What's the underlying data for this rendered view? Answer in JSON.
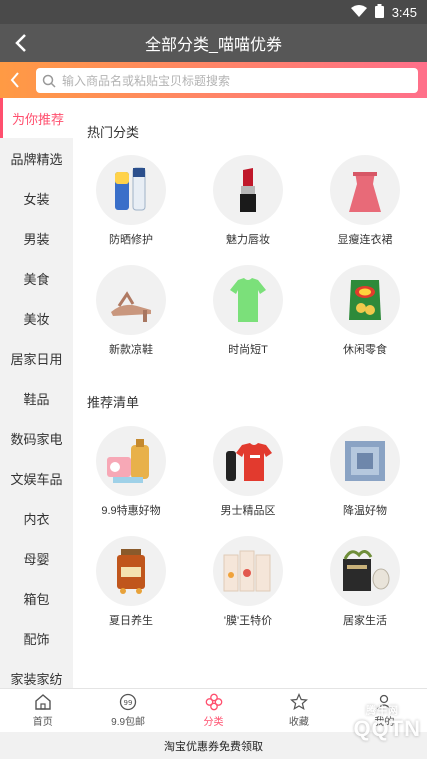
{
  "status": {
    "time": "3:45"
  },
  "header": {
    "title": "全部分类_喵喵优券"
  },
  "search": {
    "placeholder": "输入商品名或粘贴宝贝标题搜索"
  },
  "sidebar": {
    "items": [
      {
        "label": "为你推荐",
        "active": true
      },
      {
        "label": "品牌精选"
      },
      {
        "label": "女装"
      },
      {
        "label": "男装"
      },
      {
        "label": "美食"
      },
      {
        "label": "美妆"
      },
      {
        "label": "居家日用"
      },
      {
        "label": "鞋品"
      },
      {
        "label": "数码家电"
      },
      {
        "label": "文娱车品"
      },
      {
        "label": "内衣"
      },
      {
        "label": "母婴"
      },
      {
        "label": "箱包"
      },
      {
        "label": "配饰"
      },
      {
        "label": "家装家纺"
      }
    ]
  },
  "hot": {
    "title": "热门分类",
    "items": [
      {
        "label": "防晒修护",
        "icon": "sunscreen-icon"
      },
      {
        "label": "魅力唇妆",
        "icon": "lipstick-icon"
      },
      {
        "label": "显瘦连衣裙",
        "icon": "dress-icon"
      },
      {
        "label": "新款凉鞋",
        "icon": "sandal-icon"
      },
      {
        "label": "时尚短T",
        "icon": "tshirt-icon"
      },
      {
        "label": "休闲零食",
        "icon": "snack-icon"
      }
    ]
  },
  "recommend": {
    "title": "推荐清单",
    "items": [
      {
        "label": "9.9特惠好物",
        "icon": "deals-icon"
      },
      {
        "label": "男士精品区",
        "icon": "menswear-icon"
      },
      {
        "label": "降温好物",
        "icon": "blanket-icon"
      },
      {
        "label": "夏日养生",
        "icon": "honey-icon"
      },
      {
        "label": "'膜'王特价",
        "icon": "facemask-icon"
      },
      {
        "label": "居家生活",
        "icon": "home-goods-icon"
      }
    ]
  },
  "tabbar": {
    "tabs": [
      {
        "label": "首页",
        "icon": "home-icon"
      },
      {
        "label": "9.9包邮",
        "icon": "99-icon"
      },
      {
        "label": "分类",
        "icon": "category-icon",
        "active": true
      },
      {
        "label": "收藏",
        "icon": "star-icon"
      },
      {
        "label": "我的",
        "icon": "user-icon"
      }
    ]
  },
  "banner": {
    "text": "淘宝优惠券免费领取"
  },
  "watermark": {
    "text": "QQTN",
    "sub": "腾牛网"
  },
  "colors": {
    "accent": "#ff4f6e",
    "gradient_start": "#ff9a44",
    "gradient_end": "#ff6f8a",
    "titlebar": "#575757"
  }
}
